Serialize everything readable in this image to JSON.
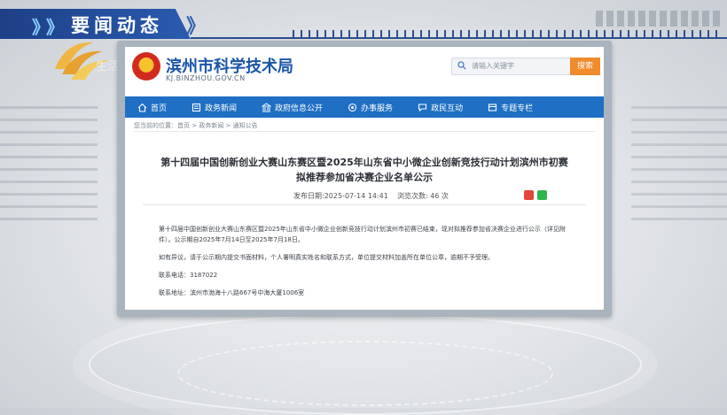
{
  "banner": {
    "title": "要闻动态",
    "chevrons": "》"
  },
  "station_logo": {
    "text": "生活"
  },
  "site": {
    "name": "滨州市科学技术局",
    "domain": "KJ.BINZHOU.GOV.CN",
    "search_placeholder": "请输入关键字",
    "search_button": "搜索"
  },
  "nav": {
    "items": [
      {
        "label": "首页",
        "icon": "home-icon"
      },
      {
        "label": "政务新闻",
        "icon": "news-icon"
      },
      {
        "label": "政府信息公开",
        "icon": "government-icon"
      },
      {
        "label": "办事服务",
        "icon": "service-icon"
      },
      {
        "label": "政民互动",
        "icon": "chat-icon"
      },
      {
        "label": "专题专栏",
        "icon": "topic-icon"
      }
    ]
  },
  "breadcrumb": "您当前的位置：首页 > 政务新闻 > 通知公告",
  "article": {
    "title_line1": "第十四届中国创新创业大赛山东赛区暨2025年山东省中小微企业创新竞技行动计划滨州市初赛",
    "title_line2": "拟推荐参加省决赛企业名单公示",
    "publish_date": "发布日期:2025-07-14 14:41",
    "views": "浏览次数:  46  次",
    "paragraphs": [
      "第十四届中国创新创业大赛山东赛区暨2025年山东省中小微企业创新竞技行动计划滨州市初赛已结束，现对拟推荐参加省决赛企业进行公示（详见附件）。公示期自2025年7月14日至2025年7月18日。",
      "如有异议，请于公示期内提交书面材料，个人署明真实姓名和联系方式，单位提交材料加盖所在单位公章，逾期不予受理。",
      "联系电话：3187022",
      "联系地址：滨州市渤海十八路667号中海大厦1006室"
    ]
  },
  "colors": {
    "banner_blue": "#1d3f86",
    "nav_blue": "#1f6fc4",
    "site_name_blue": "#1a55a8",
    "search_orange": "#f08a2b"
  }
}
